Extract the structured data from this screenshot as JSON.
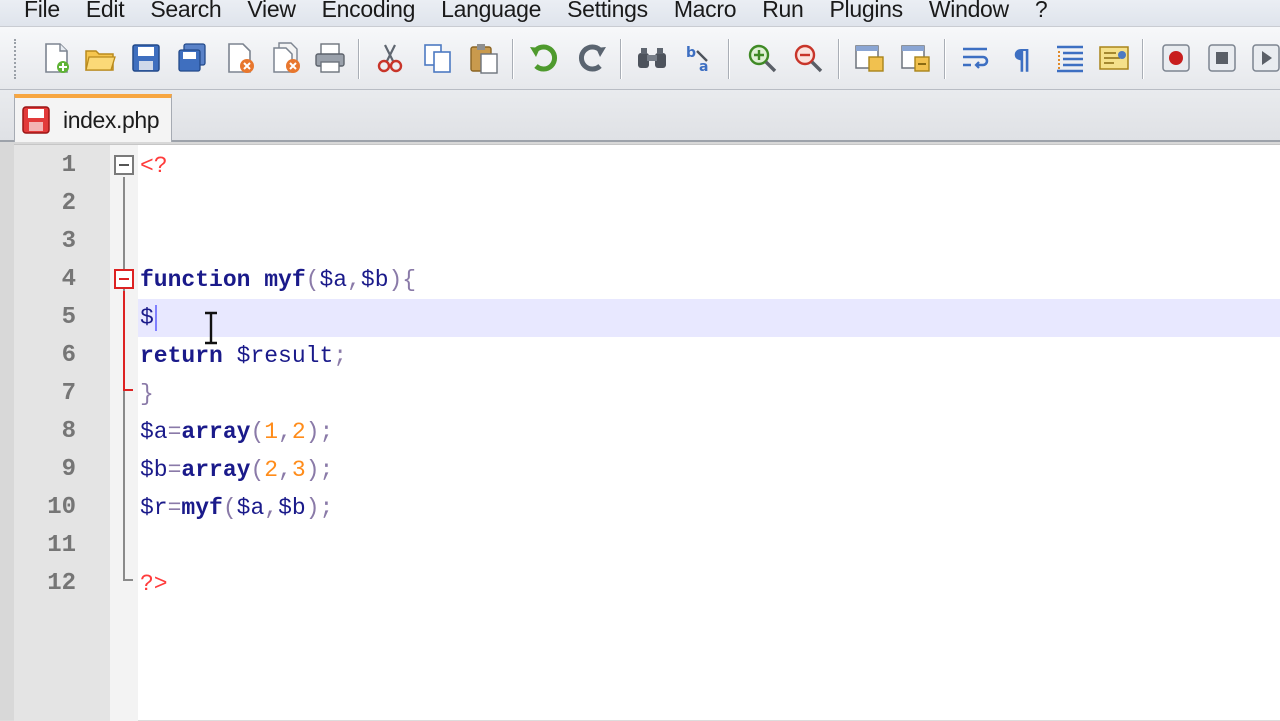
{
  "menu": [
    "File",
    "Edit",
    "Search",
    "View",
    "Encoding",
    "Language",
    "Settings",
    "Macro",
    "Run",
    "Plugins",
    "Window",
    "?"
  ],
  "toolbar": {
    "buttons": [
      "new-file-icon",
      "open-file-icon",
      "save-icon",
      "save-all-icon",
      "close-icon",
      "close-all-icon",
      "print-icon",
      "cut-icon",
      "copy-icon",
      "paste-icon",
      "undo-icon",
      "redo-icon",
      "find-icon",
      "replace-icon",
      "zoom-in-icon",
      "zoom-out-icon",
      "sync-vertical-icon",
      "sync-horizontal-icon",
      "word-wrap-icon",
      "show-all-chars-icon",
      "indent-guide-icon",
      "document-map-icon",
      "record-macro-icon",
      "stop-macro-icon",
      "play-macro-icon"
    ]
  },
  "tabs": [
    {
      "label": "index.php",
      "active": true
    }
  ],
  "editor": {
    "current_line": 5,
    "lines": [
      {
        "num": "1",
        "tokens": [
          {
            "t": "<?",
            "c": "php"
          }
        ]
      },
      {
        "num": "2",
        "tokens": []
      },
      {
        "num": "3",
        "tokens": []
      },
      {
        "num": "4",
        "tokens": [
          {
            "t": "function",
            "c": "kw"
          },
          {
            "t": " ",
            "c": "plain"
          },
          {
            "t": "myf",
            "c": "kw"
          },
          {
            "t": "(",
            "c": "op"
          },
          {
            "t": "$a",
            "c": "var"
          },
          {
            "t": ",",
            "c": "op"
          },
          {
            "t": "$b",
            "c": "var"
          },
          {
            "t": "){",
            "c": "op"
          }
        ]
      },
      {
        "num": "5",
        "tokens": [
          {
            "t": "$",
            "c": "var"
          }
        ]
      },
      {
        "num": "6",
        "tokens": [
          {
            "t": "return",
            "c": "kw"
          },
          {
            "t": " ",
            "c": "plain"
          },
          {
            "t": "$result",
            "c": "var"
          },
          {
            "t": ";",
            "c": "op"
          }
        ]
      },
      {
        "num": "7",
        "tokens": [
          {
            "t": "}",
            "c": "op"
          }
        ]
      },
      {
        "num": "8",
        "tokens": [
          {
            "t": "$a",
            "c": "var"
          },
          {
            "t": "=",
            "c": "op"
          },
          {
            "t": "array",
            "c": "kw"
          },
          {
            "t": "(",
            "c": "op"
          },
          {
            "t": "1",
            "c": "num"
          },
          {
            "t": ",",
            "c": "op"
          },
          {
            "t": "2",
            "c": "num"
          },
          {
            "t": ");",
            "c": "op"
          }
        ]
      },
      {
        "num": "9",
        "tokens": [
          {
            "t": "$b",
            "c": "var"
          },
          {
            "t": "=",
            "c": "op"
          },
          {
            "t": "array",
            "c": "kw"
          },
          {
            "t": "(",
            "c": "op"
          },
          {
            "t": "2",
            "c": "num"
          },
          {
            "t": ",",
            "c": "op"
          },
          {
            "t": "3",
            "c": "num"
          },
          {
            "t": ");",
            "c": "op"
          }
        ]
      },
      {
        "num": "10",
        "tokens": [
          {
            "t": "$r",
            "c": "var"
          },
          {
            "t": "=",
            "c": "op"
          },
          {
            "t": "myf",
            "c": "kw"
          },
          {
            "t": "(",
            "c": "op"
          },
          {
            "t": "$a",
            "c": "var"
          },
          {
            "t": ",",
            "c": "op"
          },
          {
            "t": "$b",
            "c": "var"
          },
          {
            "t": ");",
            "c": "op"
          }
        ]
      },
      {
        "num": "11",
        "tokens": []
      },
      {
        "num": "12",
        "tokens": [
          {
            "t": "?>",
            "c": "php"
          }
        ]
      }
    ]
  },
  "colors": {
    "tab_accent": "#f7a641",
    "php_tag": "#ff3b3b",
    "keyword": "#1a1a8a",
    "number": "#ff8c1a",
    "current_line": "#e8e8ff"
  }
}
